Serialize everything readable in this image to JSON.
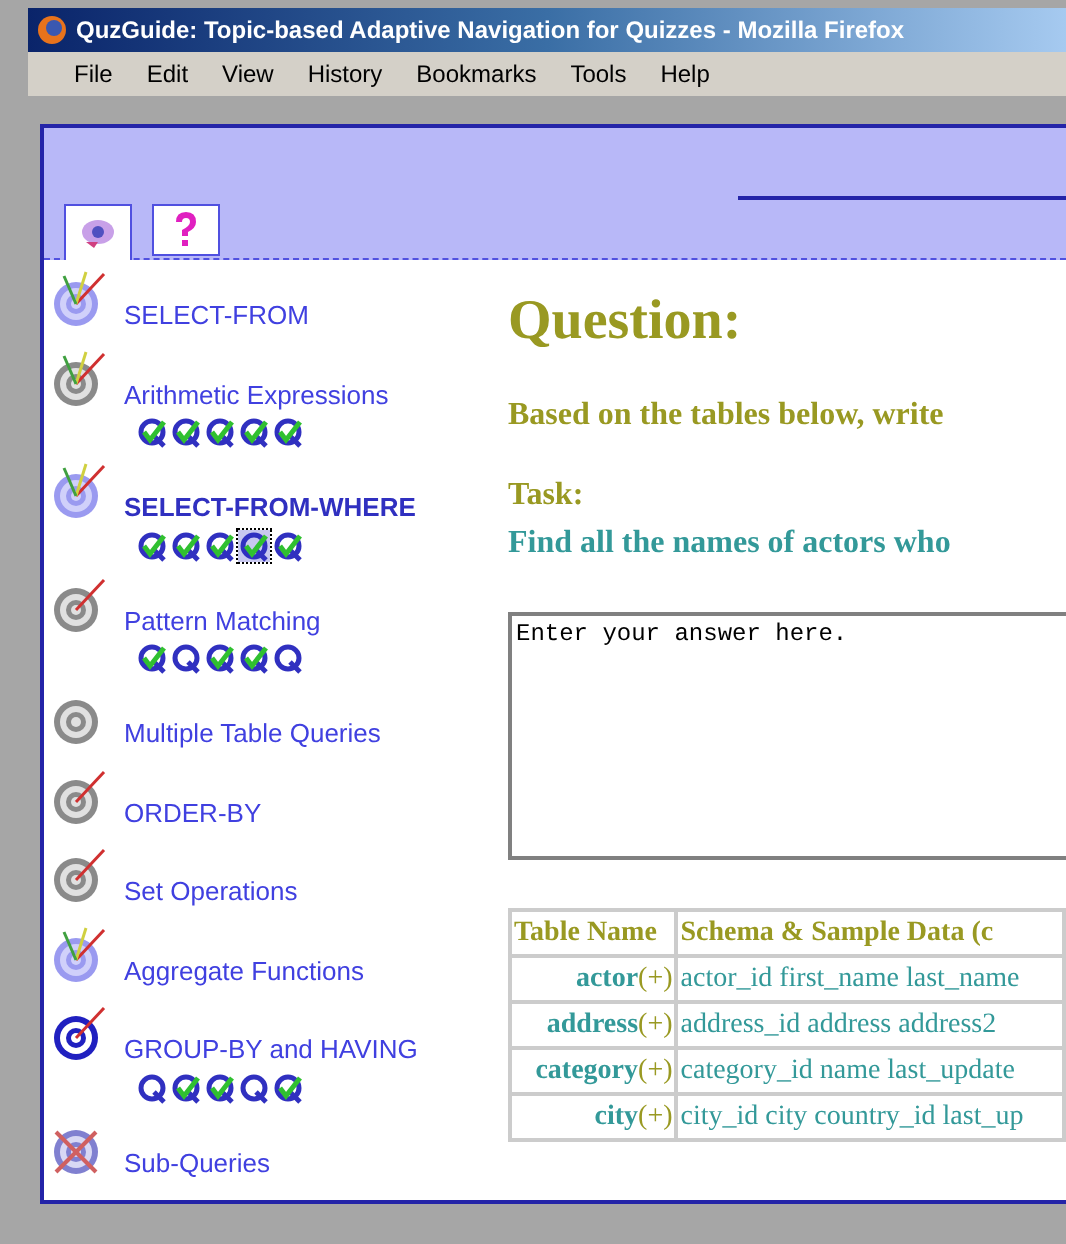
{
  "window": {
    "title": "QuzGuide: Topic-based Adaptive Navigation for Quizzes - Mozilla Firefox"
  },
  "menu": [
    "File",
    "Edit",
    "View",
    "History",
    "Bookmarks",
    "Tools",
    "Help"
  ],
  "tabs": [
    {
      "kind": "target",
      "selected": true
    },
    {
      "kind": "help",
      "selected": false
    }
  ],
  "topics": [
    {
      "label": "SELECT-FROM",
      "kind": "attempted",
      "current": false
    },
    {
      "label": "Arithmetic Expressions",
      "kind": "tried",
      "current": false,
      "questions": [
        {
          "solved": true,
          "selected": false
        },
        {
          "solved": true,
          "selected": false
        },
        {
          "solved": true,
          "selected": false
        },
        {
          "solved": true,
          "selected": false
        },
        {
          "solved": true,
          "selected": false
        }
      ]
    },
    {
      "label": "SELECT-FROM-WHERE",
      "kind": "attempted",
      "current": true,
      "questions": [
        {
          "solved": true,
          "selected": false
        },
        {
          "solved": true,
          "selected": false
        },
        {
          "solved": true,
          "selected": false
        },
        {
          "solved": true,
          "selected": true
        },
        {
          "solved": true,
          "selected": false
        }
      ]
    },
    {
      "label": "Pattern Matching",
      "kind": "started",
      "current": false,
      "questions": [
        {
          "solved": true,
          "selected": false
        },
        {
          "solved": false,
          "selected": false
        },
        {
          "solved": true,
          "selected": false
        },
        {
          "solved": true,
          "selected": false
        },
        {
          "solved": false,
          "selected": false
        }
      ]
    },
    {
      "label": "Multiple Table Queries",
      "kind": "untouched",
      "current": false
    },
    {
      "label": "ORDER-BY",
      "kind": "started",
      "current": false
    },
    {
      "label": "Set Operations",
      "kind": "started",
      "current": false
    },
    {
      "label": "Aggregate Functions",
      "kind": "attempted",
      "current": false
    },
    {
      "label": "GROUP-BY and HAVING",
      "kind": "focus",
      "current": false,
      "questions": [
        {
          "solved": false,
          "selected": false
        },
        {
          "solved": true,
          "selected": false
        },
        {
          "solved": true,
          "selected": false
        },
        {
          "solved": false,
          "selected": false
        },
        {
          "solved": true,
          "selected": false
        }
      ]
    },
    {
      "label": "Sub-Queries",
      "kind": "locked",
      "current": false
    }
  ],
  "question": {
    "heading": "Question:",
    "prompt": "Based on the tables below, write",
    "task_label": "Task:",
    "task": "Find all the names of actors who",
    "answer": {
      "value": "Enter your answer here."
    }
  },
  "table": {
    "columns": [
      "Table Name",
      "Schema & Sample Data (c"
    ],
    "rows": [
      {
        "name": "actor",
        "expand": "(+)",
        "schema": "actor_id first_name last_name"
      },
      {
        "name": "address",
        "expand": "(+)",
        "schema": "address_id address address2"
      },
      {
        "name": "category",
        "expand": "(+)",
        "schema": "category_id name last_update"
      },
      {
        "name": "city",
        "expand": "(+)",
        "schema": "city_id city country_id last_up"
      }
    ]
  }
}
